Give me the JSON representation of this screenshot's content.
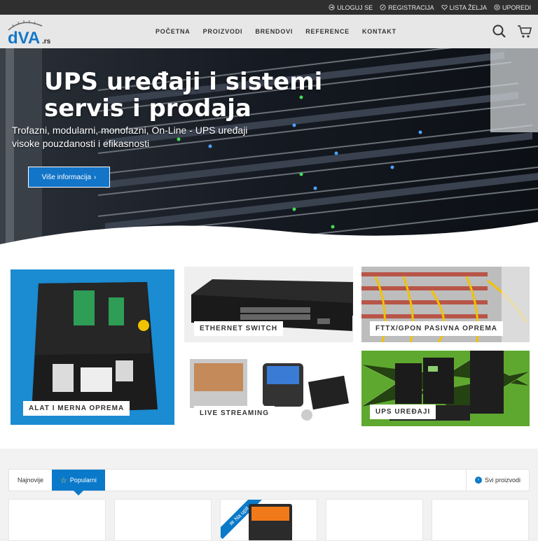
{
  "topbar": {
    "login": "ULOGUJ SE",
    "register": "REGISTRACIJA",
    "wishlist": "LISTA ŽELJA",
    "compare": "UPOREDI"
  },
  "logo": {
    "text": "dVA",
    "tld": ".rs"
  },
  "nav": [
    "POČETNA",
    "PROIZVODI",
    "BRENDOVI",
    "REFERENCE",
    "KONTAKT"
  ],
  "hero": {
    "title": "UPS uređaji i sistemi servis i prodaja",
    "subtitle": "Trofazni, modularni, monofazni, On-Line - UPS uređaji visoke pouzdanosti i efikasnosti",
    "button": "Više informacija"
  },
  "categories": [
    {
      "label": "ALAT I MERNA OPREMA"
    },
    {
      "label": "ETHERNET SWITCH"
    },
    {
      "label": "FTTX/GPON PASIVNA OPREMA"
    },
    {
      "label": "LIVE STREAMING"
    },
    {
      "label": "UPS UREĐAJI"
    }
  ],
  "products": {
    "tab_new": "Najnovije",
    "tab_popular": "Popularni",
    "all_products": "Svi proizvodi",
    "ribbon": "Na upit"
  },
  "colors": {
    "accent": "#0b79c9",
    "topbar": "#2f2f2f",
    "header": "#e7e7e7"
  }
}
